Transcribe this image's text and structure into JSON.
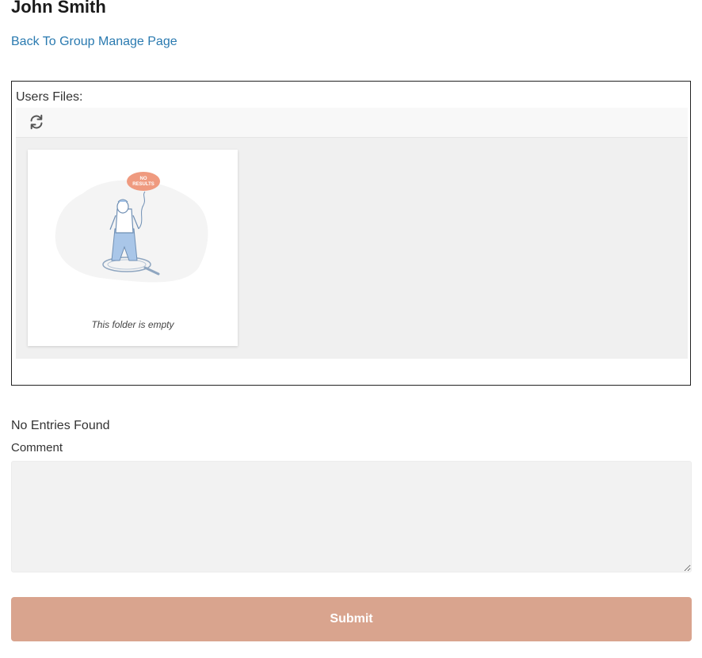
{
  "header": {
    "user_name": "John Smith",
    "back_link": "Back To Group Manage Page"
  },
  "files": {
    "label": "Users Files:",
    "toolbar": {
      "refresh_icon": "refresh-icon"
    },
    "empty_illustration_badge": [
      "NO",
      "RESULTS"
    ],
    "empty_text": "This folder is empty"
  },
  "entries": {
    "status": "No Entries Found"
  },
  "comment": {
    "label": "Comment",
    "value": "",
    "placeholder": ""
  },
  "submit": {
    "label": "Submit"
  },
  "colors": {
    "link": "#2a7ab0",
    "submit_bg": "#d9a48e",
    "badge": "#ef9a7f",
    "panel_bg": "#f0f0f0",
    "input_bg": "#f2f2f2"
  }
}
